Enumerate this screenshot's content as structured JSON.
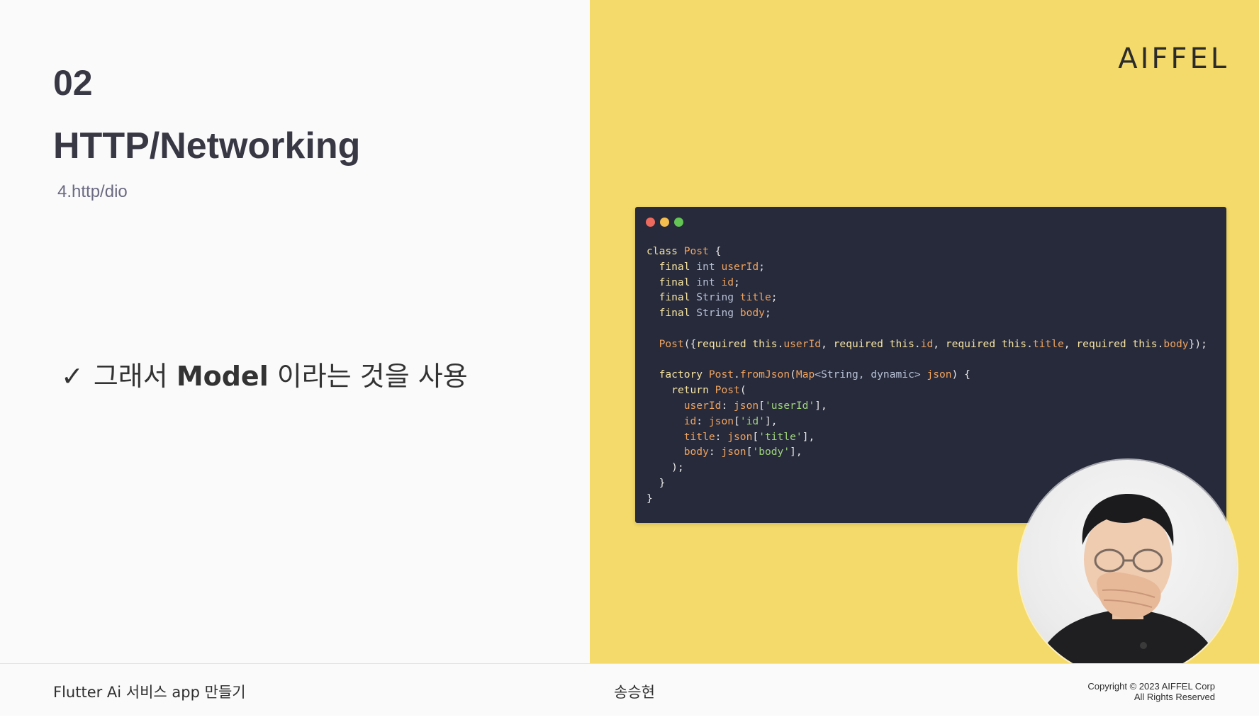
{
  "slide": {
    "section_number": "02",
    "title": "HTTP/Networking",
    "subtitle": "4.http/dio",
    "bullet": {
      "check": "✓",
      "prefix": "그래서 ",
      "bold": "Model",
      "suffix": " 이라는 것을 사용"
    },
    "brand": "AIFFEL"
  },
  "code_window": {
    "dot_colors": [
      "#ee6a5e",
      "#f5bf4f",
      "#62c554"
    ],
    "background": "#262a3b",
    "lines": [
      [
        [
          "kw",
          "class "
        ],
        [
          "cls",
          "Post"
        ],
        [
          "punc",
          " {"
        ]
      ],
      [
        [
          "punc",
          "  "
        ],
        [
          "kw",
          "final "
        ],
        [
          "type",
          "int "
        ],
        [
          "id",
          "userId"
        ],
        [
          "punc",
          ";"
        ]
      ],
      [
        [
          "punc",
          "  "
        ],
        [
          "kw",
          "final "
        ],
        [
          "type",
          "int "
        ],
        [
          "id",
          "id"
        ],
        [
          "punc",
          ";"
        ]
      ],
      [
        [
          "punc",
          "  "
        ],
        [
          "kw",
          "final "
        ],
        [
          "type",
          "String "
        ],
        [
          "id",
          "title"
        ],
        [
          "punc",
          ";"
        ]
      ],
      [
        [
          "punc",
          "  "
        ],
        [
          "kw",
          "final "
        ],
        [
          "type",
          "String "
        ],
        [
          "id",
          "body"
        ],
        [
          "punc",
          ";"
        ]
      ],
      [
        [
          "punc",
          ""
        ]
      ],
      [
        [
          "punc",
          "  "
        ],
        [
          "fn",
          "Post"
        ],
        [
          "punc",
          "({"
        ],
        [
          "kw",
          "required this"
        ],
        [
          "punc",
          "."
        ],
        [
          "id",
          "userId"
        ],
        [
          "punc",
          ", "
        ],
        [
          "kw",
          "required this"
        ],
        [
          "punc",
          "."
        ],
        [
          "id",
          "id"
        ],
        [
          "punc",
          ", "
        ],
        [
          "kw",
          "required this"
        ],
        [
          "punc",
          "."
        ],
        [
          "id",
          "title"
        ],
        [
          "punc",
          ", "
        ],
        [
          "kw",
          "required this"
        ],
        [
          "punc",
          "."
        ],
        [
          "id",
          "body"
        ],
        [
          "punc",
          "});"
        ]
      ],
      [
        [
          "punc",
          ""
        ]
      ],
      [
        [
          "punc",
          "  "
        ],
        [
          "kw",
          "factory "
        ],
        [
          "fn",
          "Post"
        ],
        [
          "punc",
          "."
        ],
        [
          "fn",
          "fromJson"
        ],
        [
          "punc",
          "("
        ],
        [
          "cls",
          "Map"
        ],
        [
          "type",
          "<String, dynamic> "
        ],
        [
          "id",
          "json"
        ],
        [
          "punc",
          ") {"
        ]
      ],
      [
        [
          "punc",
          "    "
        ],
        [
          "kw",
          "return "
        ],
        [
          "fn",
          "Post"
        ],
        [
          "punc",
          "("
        ]
      ],
      [
        [
          "punc",
          "      "
        ],
        [
          "id",
          "userId"
        ],
        [
          "punc",
          ": "
        ],
        [
          "id",
          "json"
        ],
        [
          "punc",
          "["
        ],
        [
          "str",
          "'userId'"
        ],
        [
          "punc",
          "],"
        ]
      ],
      [
        [
          "punc",
          "      "
        ],
        [
          "id",
          "id"
        ],
        [
          "punc",
          ": "
        ],
        [
          "id",
          "json"
        ],
        [
          "punc",
          "["
        ],
        [
          "str",
          "'id'"
        ],
        [
          "punc",
          "],"
        ]
      ],
      [
        [
          "punc",
          "      "
        ],
        [
          "id",
          "title"
        ],
        [
          "punc",
          ": "
        ],
        [
          "id",
          "json"
        ],
        [
          "punc",
          "["
        ],
        [
          "str",
          "'title'"
        ],
        [
          "punc",
          "],"
        ]
      ],
      [
        [
          "punc",
          "      "
        ],
        [
          "id",
          "body"
        ],
        [
          "punc",
          ": "
        ],
        [
          "id",
          "json"
        ],
        [
          "punc",
          "["
        ],
        [
          "str",
          "'body'"
        ],
        [
          "punc",
          "],"
        ]
      ],
      [
        [
          "punc",
          "    );"
        ]
      ],
      [
        [
          "punc",
          "  }"
        ]
      ],
      [
        [
          "punc",
          "}"
        ]
      ]
    ]
  },
  "footer": {
    "course": "Flutter Ai 서비스 app 만들기",
    "presenter": "송승현",
    "copyright_line1": "Copyright © 2023 AIFFEL Corp",
    "copyright_line2": "All Rights Reserved"
  },
  "colors": {
    "accent_yellow": "#f4da6a",
    "title_dark": "#383744",
    "subtitle_gray": "#6a6a82",
    "code_bg": "#262a3b"
  }
}
